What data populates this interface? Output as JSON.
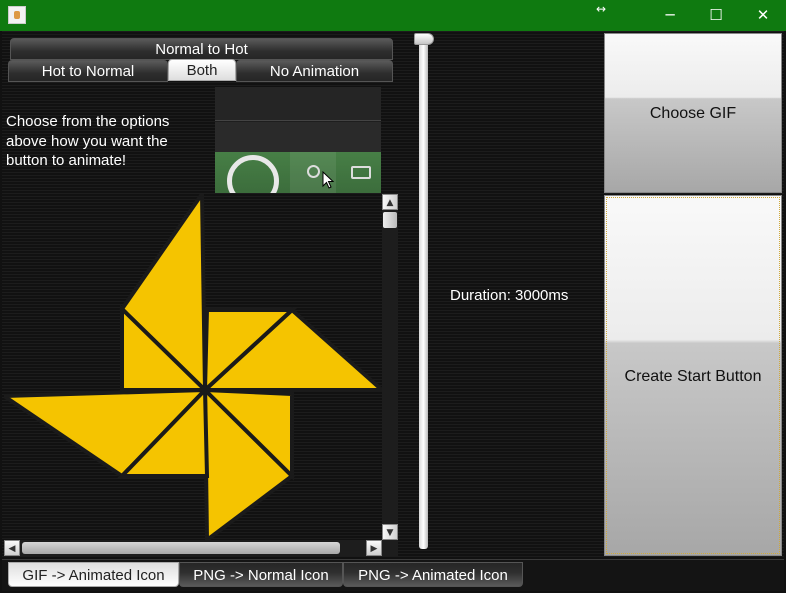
{
  "window": {
    "controls": {
      "resize_glyph": "↔",
      "minimize": "─",
      "maximize": "☐",
      "close": "✕"
    }
  },
  "animation_tabs": {
    "row1": [
      "Normal to Hot"
    ],
    "row2": [
      "Hot to Normal",
      "Both",
      "No Animation"
    ],
    "selected": "Both"
  },
  "description": "Choose from the options above how you want the button to animate!",
  "slider": {
    "orientation": "vertical",
    "value_fraction": 0.0
  },
  "duration_label": "Duration: 3000ms",
  "buttons": {
    "choose_gif": "Choose GIF",
    "create_start_button": "Create Start Button"
  },
  "bottom_tabs": {
    "items": [
      "GIF -> Animated Icon",
      "PNG -> Normal Icon",
      "PNG -> Animated Icon"
    ],
    "selected": "GIF -> Animated Icon"
  },
  "colors": {
    "titlebar": "#0f7a10",
    "pinwheel": "#f5c400",
    "background": "#141414"
  },
  "icons": [
    "java-app-icon",
    "resize-icon",
    "minimize-icon",
    "maximize-icon",
    "close-icon",
    "ring-icon",
    "search-circle-icon",
    "tablet-icon",
    "pinwheel-image"
  ]
}
